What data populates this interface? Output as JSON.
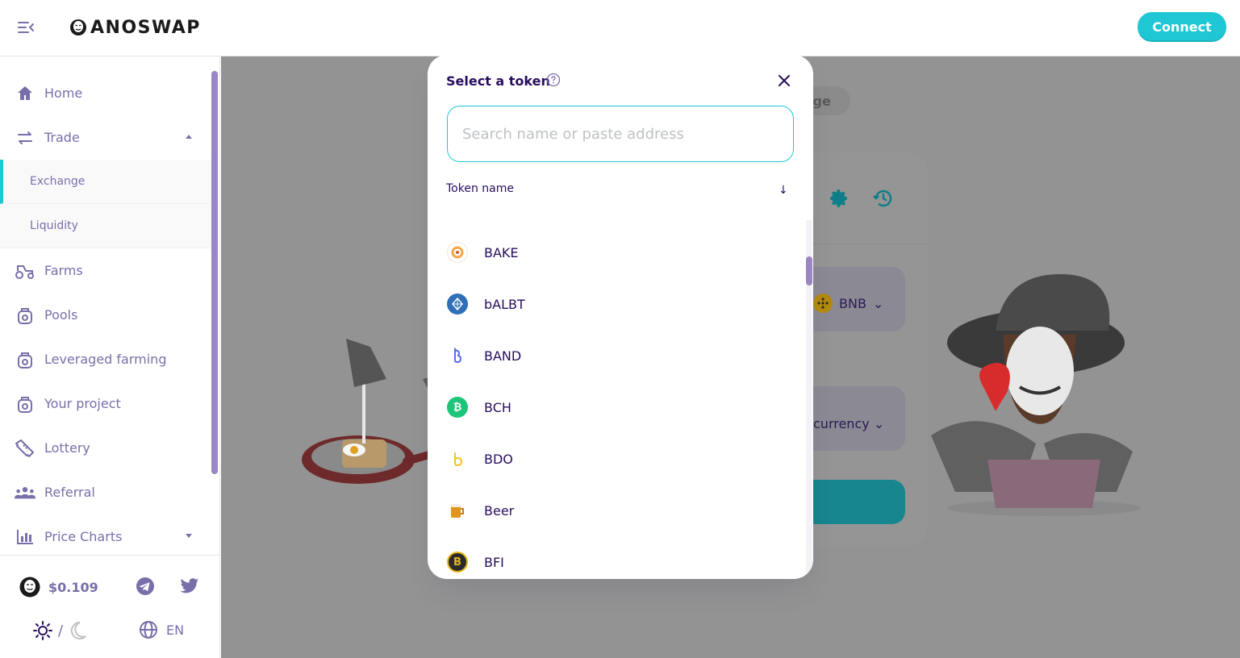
{
  "header": {
    "logo_text": "ANOSWAP",
    "connect_label": "Connect"
  },
  "sidebar": {
    "items": [
      {
        "label": "Home",
        "icon": "home-icon"
      },
      {
        "label": "Trade",
        "icon": "trade-icon",
        "expanded": true,
        "children": [
          {
            "label": "Exchange",
            "active": true
          },
          {
            "label": "Liquidity"
          }
        ]
      },
      {
        "label": "Farms",
        "icon": "tractor-icon"
      },
      {
        "label": "Pools",
        "icon": "pool-icon"
      },
      {
        "label": "Leveraged farming",
        "icon": "pool-icon"
      },
      {
        "label": "Your project",
        "icon": "pool-icon"
      },
      {
        "label": "Lottery",
        "icon": "ticket-icon"
      },
      {
        "label": "Referral",
        "icon": "group-icon"
      },
      {
        "label": "Price Charts",
        "icon": "chart-icon",
        "expanded": false
      }
    ],
    "footer": {
      "price": "$0.109",
      "lang": "EN",
      "theme_separator": "/"
    }
  },
  "background": {
    "bridge_partial": "lge",
    "from_token": "BNB",
    "to_token_partial": "currency"
  },
  "modal": {
    "title": "Select a token",
    "search_placeholder": "Search name or paste address",
    "column_header": "Token name",
    "sort_arrow": "↓",
    "tokens": [
      {
        "symbol": "BAKE",
        "color": "#f7a544"
      },
      {
        "symbol": "bALBT",
        "color": "#2e6fb7"
      },
      {
        "symbol": "BAND",
        "color": "#5a6cf0"
      },
      {
        "symbol": "BCH",
        "color": "#1ec47a"
      },
      {
        "symbol": "BDO",
        "color": "#f2c230"
      },
      {
        "symbol": "Beer",
        "color": "#d88c1f"
      },
      {
        "symbol": "BFI",
        "color": "#2b2b2b"
      }
    ]
  },
  "colors": {
    "accent": "#1fc7d4",
    "text": "#280d5f",
    "secondary": "#7a6eaa",
    "overlay": "#949394"
  }
}
